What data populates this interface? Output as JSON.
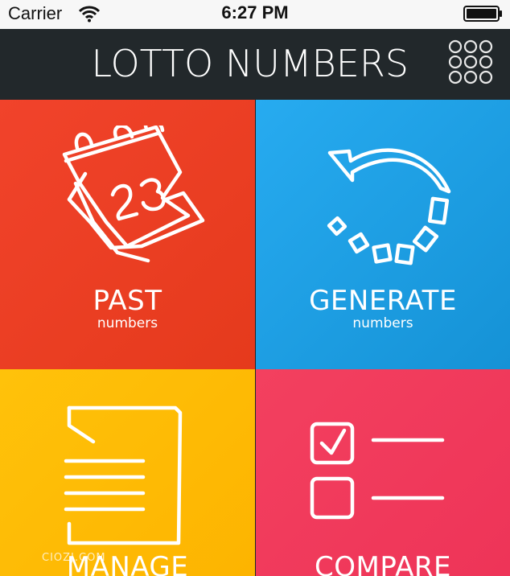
{
  "status_bar": {
    "carrier": "Carrier",
    "time": "6:27 PM"
  },
  "nav": {
    "title": "LOTTO NUMBERS",
    "menu_icon": "grid-dots-icon"
  },
  "tiles": [
    {
      "main": "PAST",
      "sub": "numbers",
      "icon": "calendar-icon",
      "color": "#e93f22"
    },
    {
      "main": "GENERATE",
      "sub": "numbers",
      "icon": "refresh-icon",
      "color": "#1e9fe3"
    },
    {
      "main": "MANAGE",
      "sub": "",
      "icon": "document-icon",
      "color": "#ffbe04"
    },
    {
      "main": "COMPARE",
      "sub": "",
      "icon": "checklist-icon",
      "color": "#f03a5b"
    }
  ],
  "watermark": "CIOZJ.COM"
}
